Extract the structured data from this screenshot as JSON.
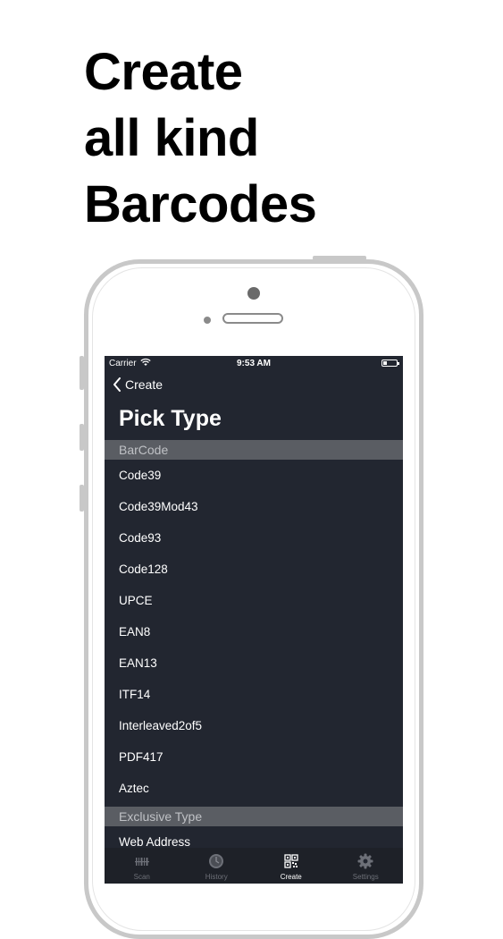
{
  "headline": [
    "Create",
    "all kind",
    "Barcodes"
  ],
  "status_bar": {
    "carrier": "Carrier",
    "time": "9:53 AM"
  },
  "nav": {
    "back_label": "Create",
    "title": "Pick Type"
  },
  "sections": [
    {
      "header": "BarCode",
      "items": [
        "Code39",
        "Code39Mod43",
        "Code93",
        "Code128",
        "UPCE",
        "EAN8",
        "EAN13",
        "ITF14",
        "Interleaved2of5",
        "PDF417",
        "Aztec"
      ]
    },
    {
      "header": "Exclusive Type",
      "items": [
        "Web Address"
      ]
    }
  ],
  "tab_bar": {
    "tabs": [
      {
        "label": "Scan",
        "icon": "barcode-scan-icon",
        "active": false
      },
      {
        "label": "History",
        "icon": "clock-icon",
        "active": false
      },
      {
        "label": "Create",
        "icon": "qr-code-icon",
        "active": true
      },
      {
        "label": "Settings",
        "icon": "gear-icon",
        "active": false
      }
    ]
  },
  "colors": {
    "screen_bg": "#222630",
    "section_header_bg": "#5a5d63",
    "frame": "#c8c8c8"
  }
}
